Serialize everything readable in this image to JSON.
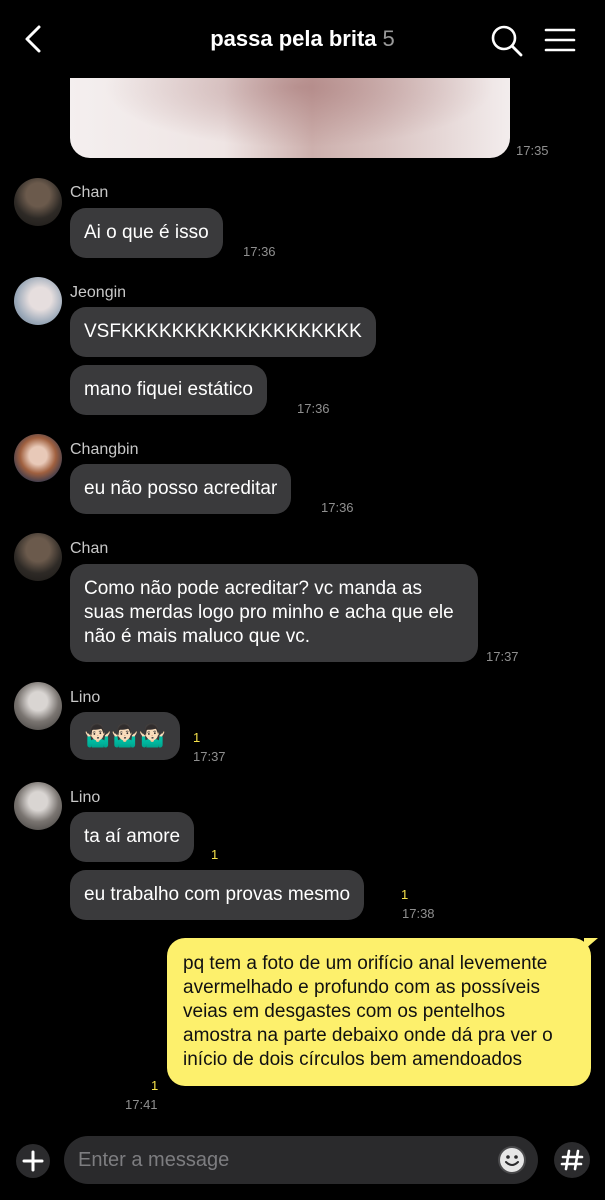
{
  "header": {
    "title": "passa pela brita",
    "member_count": "5"
  },
  "top_image": {
    "time": "17:35"
  },
  "messages": [
    {
      "sender": "Chan",
      "bubbles": [
        "Ai o que é isso"
      ],
      "time": "17:36"
    },
    {
      "sender": "Jeongin",
      "bubbles": [
        "VSFKKKKKKKKKKKKKKKKKKK",
        "mano fiquei estático"
      ],
      "time": "17:36"
    },
    {
      "sender": "Changbin",
      "bubbles": [
        "eu não posso acreditar"
      ],
      "time": "17:36"
    },
    {
      "sender": "Chan",
      "bubbles": [
        "Como não pode acreditar? vc manda as suas merdas logo pro minho e acha que ele não é mais maluco que vc."
      ],
      "time": "17:37"
    },
    {
      "sender": "Lino",
      "bubbles": [
        "🤷🏻‍♂️🤷🏻‍♂️🤷🏻‍♂️"
      ],
      "unread": "1",
      "time": "17:37"
    },
    {
      "sender": "Lino",
      "bubbles": [
        "ta aí amore",
        "eu trabalho com provas mesmo"
      ],
      "unread": [
        "1",
        "1"
      ],
      "time": "17:38"
    }
  ],
  "my_message": {
    "text": "pq tem a foto de um orifício anal levemente avermelhado e profundo com as possíveis veias em desgastes com os pentelhos amostra na parte debaixo onde dá pra ver o início de dois círculos bem amendoados",
    "unread": "1",
    "time": "17:41"
  },
  "composer": {
    "placeholder": "Enter a message"
  },
  "icons": {
    "back": "chevron-left-icon",
    "search": "search-icon",
    "menu": "hamburger-menu-icon",
    "plus": "plus-icon",
    "emoji": "smiley-icon",
    "hashtag": "hash-icon"
  },
  "colors": {
    "background": "#000000",
    "bubble_other": "#3a3a3c",
    "bubble_mine": "#fdf06c",
    "unread": "#f5e14b"
  }
}
